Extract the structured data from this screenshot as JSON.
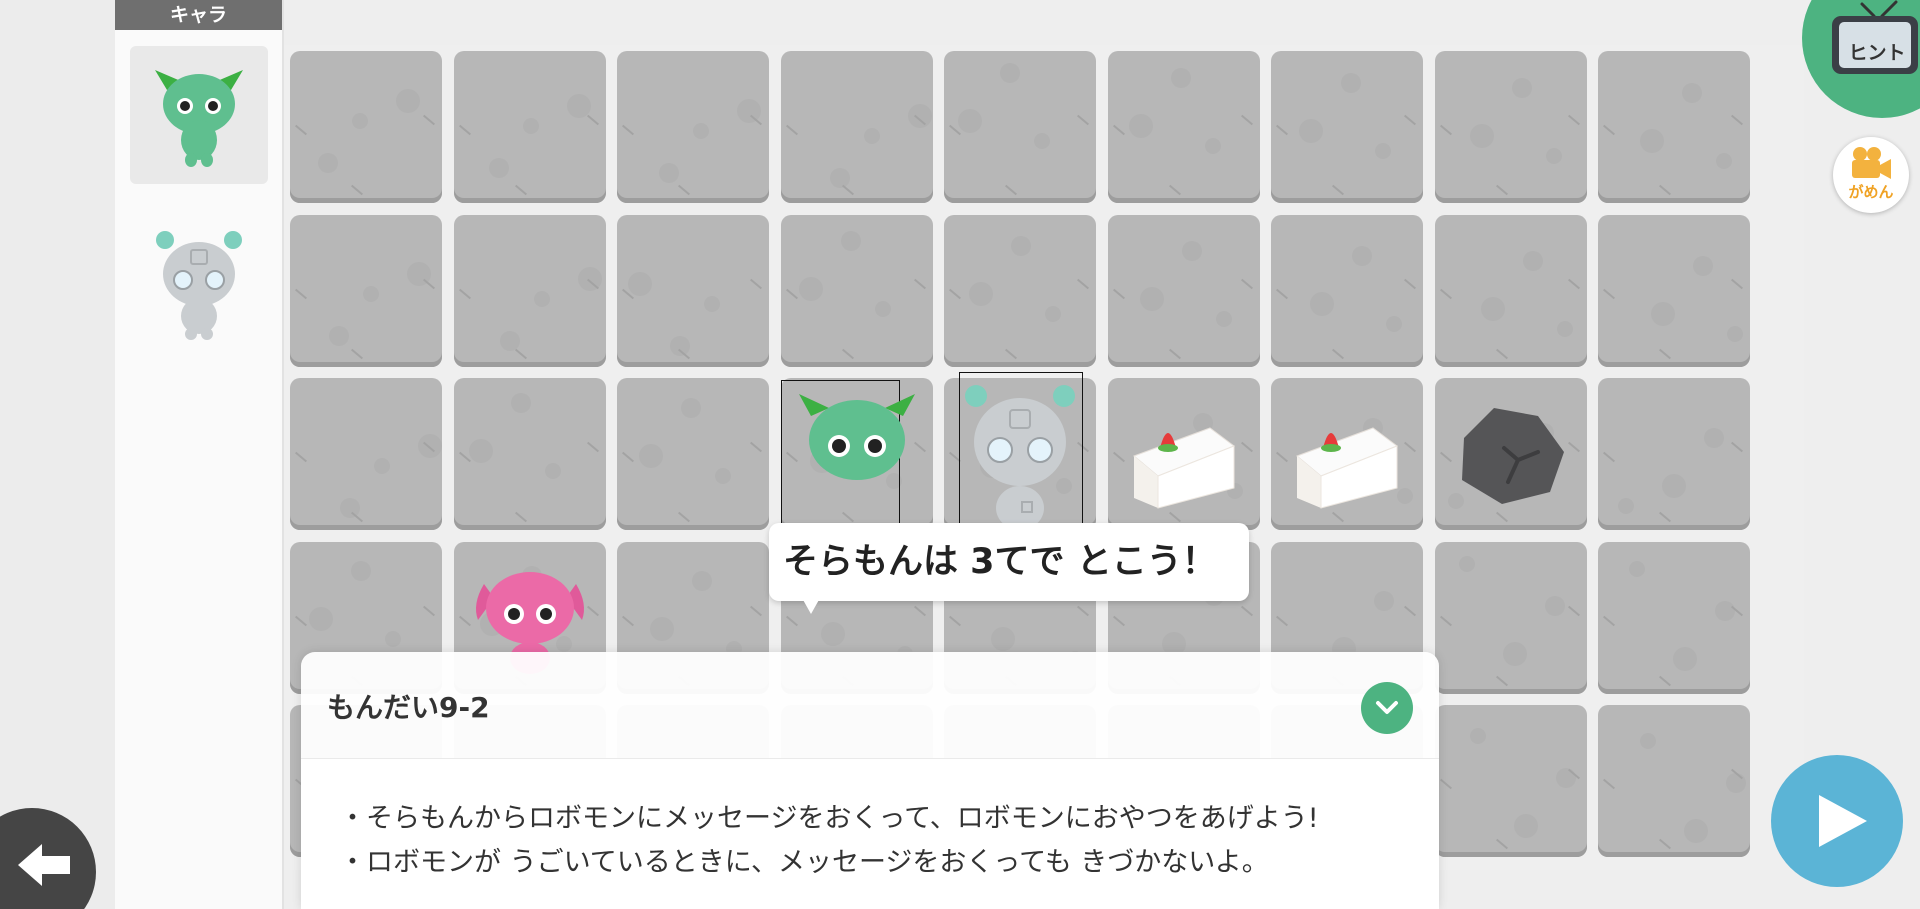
{
  "character_panel": {
    "header": "キャラ",
    "characters": [
      "green-monster",
      "robomon"
    ]
  },
  "stage": {
    "rows": 5,
    "cols": 9,
    "items": [
      {
        "row": 2,
        "col": 3,
        "kind": "green-monster",
        "selected": true
      },
      {
        "row": 2,
        "col": 4,
        "kind": "robomon",
        "selected": true
      },
      {
        "row": 2,
        "col": 5,
        "kind": "cake"
      },
      {
        "row": 2,
        "col": 6,
        "kind": "cake"
      },
      {
        "row": 2,
        "col": 7,
        "kind": "rock"
      },
      {
        "row": 3,
        "col": 1,
        "kind": "soramon"
      }
    ]
  },
  "speech_bubble": {
    "text": "そらもんは 3てで とこう！"
  },
  "problem": {
    "title": "もんだい9-2",
    "lines": [
      "・そらもんからロボモンにメッセージをおくって、ロボモンにおやつをあげよう!",
      "・ロボモンが うごいているときに、メッセージをおくっても きづかないよ。"
    ]
  },
  "controls": {
    "hint_label": "ヒント",
    "record_label": "がめん"
  },
  "colors": {
    "accent_green": "#4db381",
    "play_blue": "#5bb4d6",
    "tile_gray": "#b7b7b7",
    "record_orange": "#f0a224"
  },
  "icons": [
    "tv-icon",
    "video-camera-icon",
    "play-icon",
    "back-arrow-icon",
    "chevron-down-icon"
  ]
}
